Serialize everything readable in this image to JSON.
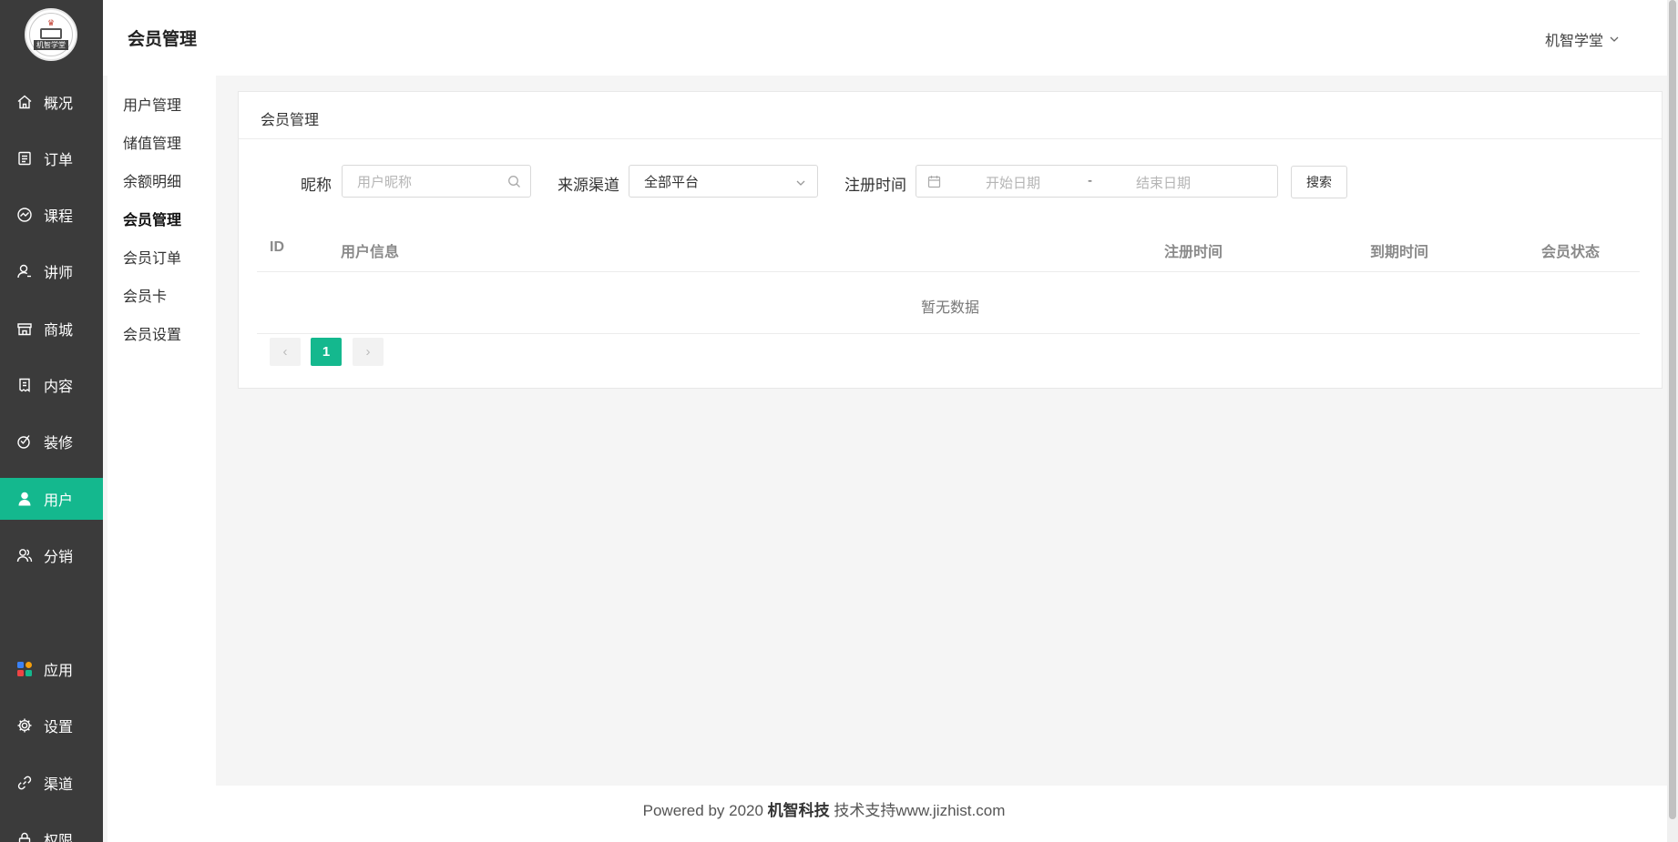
{
  "brand": {
    "logo_text": "机智学堂"
  },
  "nav": [
    {
      "label": "概况",
      "icon": "home-icon",
      "active": false
    },
    {
      "label": "订单",
      "icon": "order-icon",
      "active": false
    },
    {
      "label": "课程",
      "icon": "course-icon",
      "active": false
    },
    {
      "label": "讲师",
      "icon": "teacher-icon",
      "active": false
    },
    {
      "label": "商城",
      "icon": "store-icon",
      "active": false
    },
    {
      "label": "内容",
      "icon": "content-icon",
      "active": false
    },
    {
      "label": "装修",
      "icon": "decorate-icon",
      "active": false
    },
    {
      "label": "用户",
      "icon": "user-icon",
      "active": true
    },
    {
      "label": "分销",
      "icon": "distribution-icon",
      "active": false
    },
    {
      "label": "应用",
      "icon": "apps-icon",
      "active": false
    },
    {
      "label": "设置",
      "icon": "gear-icon",
      "active": false
    },
    {
      "label": "渠道",
      "icon": "link-icon",
      "active": false
    },
    {
      "label": "权限",
      "icon": "lock-icon",
      "active": false
    }
  ],
  "header": {
    "title": "会员管理",
    "user_name": "机智学堂"
  },
  "subnav": [
    {
      "label": "用户管理",
      "active": false
    },
    {
      "label": "储值管理",
      "active": false
    },
    {
      "label": "余额明细",
      "active": false
    },
    {
      "label": "会员管理",
      "active": true
    },
    {
      "label": "会员订单",
      "active": false
    },
    {
      "label": "会员卡",
      "active": false
    },
    {
      "label": "会员设置",
      "active": false
    }
  ],
  "card": {
    "title": "会员管理"
  },
  "filters": {
    "nickname_label": "昵称",
    "nickname_placeholder": "用户昵称",
    "channel_label": "来源渠道",
    "channel_value": "全部平台",
    "regtime_label": "注册时间",
    "start_placeholder": "开始日期",
    "range_sep": "-",
    "end_placeholder": "结束日期",
    "search_label": "搜索"
  },
  "table": {
    "columns": [
      "ID",
      "用户信息",
      "注册时间",
      "到期时间",
      "会员状态"
    ],
    "rows": [],
    "empty_text": "暂无数据"
  },
  "pagination": {
    "current": "1",
    "prev": "‹",
    "next": "›"
  },
  "footer": {
    "prefix": "Powered by 2020 ",
    "company": "机智科技",
    "suffix": " 技术支持www.jizhist.com"
  },
  "colors": {
    "accent": "#14b88e",
    "nav_bg": "#3b3b3b"
  }
}
